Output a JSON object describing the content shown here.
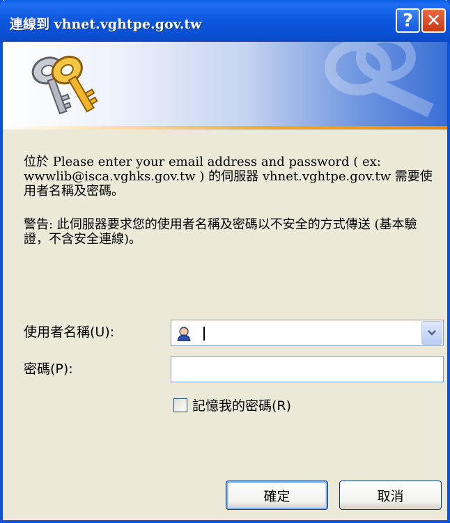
{
  "window": {
    "title": "連線到 vhnet.vghtpe.gov.tw",
    "help_label": "?",
    "close_label": "✕"
  },
  "message": {
    "line1": "位於 Please enter your email address and password ( ex: wwwlib@isca.vghks.gov.tw ) 的伺服器 vhnet.vghtpe.gov.tw 需要使用者名稱及密碼。",
    "warning": "警告: 此伺服器要求您的使用者名稱及密碼以不安全的方式傳送 (基本驗證，不含安全連線)。"
  },
  "form": {
    "username_label": "使用者名稱(U):",
    "username_value": "",
    "password_label": "密碼(P):",
    "password_value": "",
    "remember_label": "記憶我的密碼(R)",
    "remember_checked": false
  },
  "buttons": {
    "ok": "確定",
    "cancel": "取消"
  },
  "icons": {
    "banner": "keys-icon",
    "user": "user-icon",
    "dropdown": "chevron-down-icon"
  },
  "colors": {
    "titlebar": "#0a52d8",
    "dialog_bg": "#ece9d8",
    "close": "#c83916"
  }
}
